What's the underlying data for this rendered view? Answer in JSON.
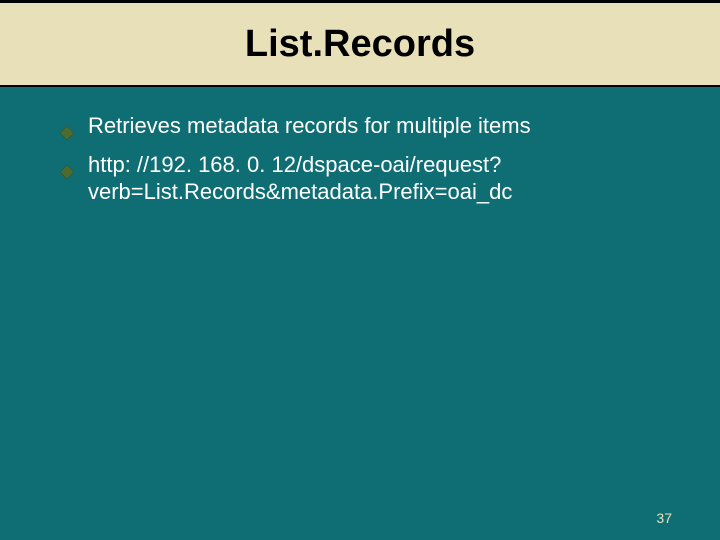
{
  "title": "List.Records",
  "bullets": [
    "Retrieves metadata records for multiple items",
    "http: //192. 168. 0. 12/dspace-oai/request? verb=List.Records&metadata.Prefix=oai_dc"
  ],
  "page_number": "37",
  "colors": {
    "background": "#0f6d74",
    "band": "#e8e0b8",
    "bullet_fill": "#4b6b2f"
  }
}
